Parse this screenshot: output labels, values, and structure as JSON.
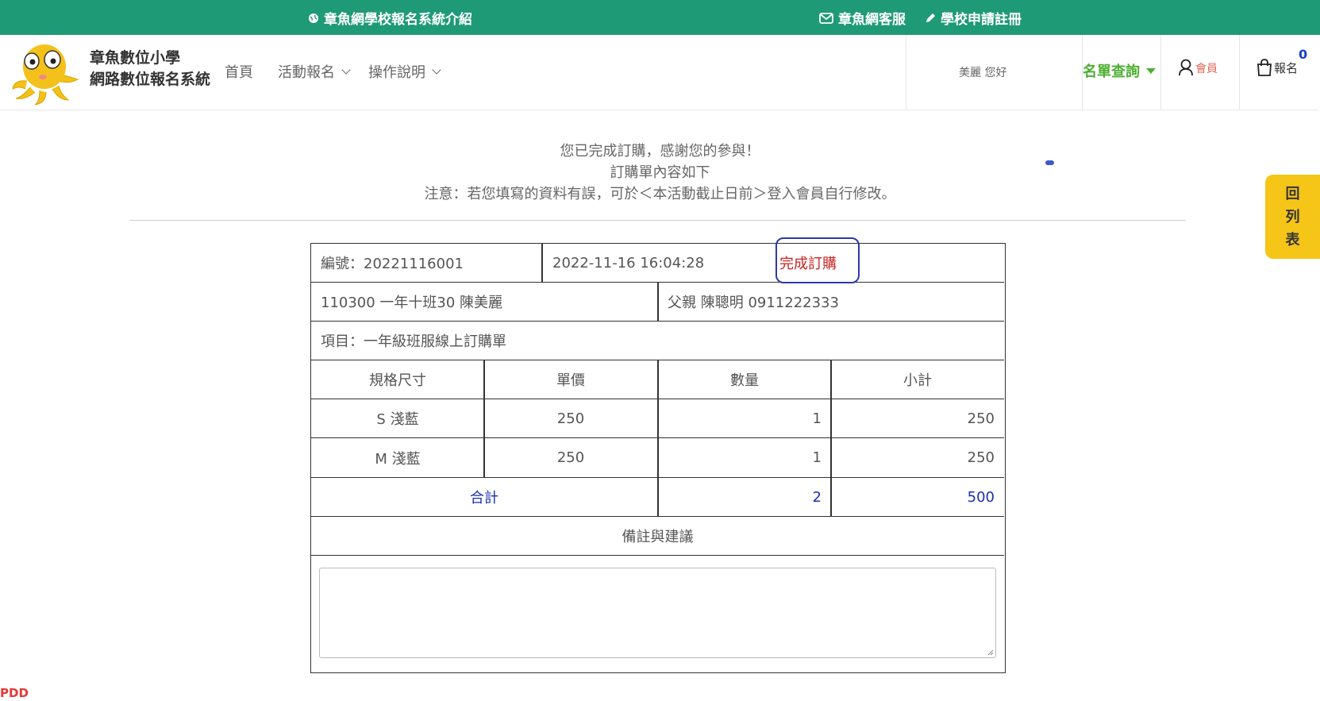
{
  "topbar": {
    "intro": "章魚網學校報名系統介紹",
    "service": "章魚網客服",
    "register": "學校申請註冊",
    "bg_color": "#1f9a76"
  },
  "header": {
    "brand_line1": "章魚數位小學",
    "brand_line2": "網路數位報名系統",
    "nav": {
      "home": "首頁",
      "activity": "活動報名",
      "help": "操作說明"
    },
    "greeting": "美麗 您好",
    "list_query": "名單查詢",
    "member": "會員",
    "signup": "報名",
    "cart_count": "0"
  },
  "messages": {
    "line1": "您已完成訂購，感謝您的參與！",
    "line2": "訂購單內容如下",
    "line3": "注意：若您填寫的資料有誤，可於＜本活動截止日前＞登入會員自行修改。"
  },
  "side_tab": {
    "text": "回列表"
  },
  "order": {
    "number": "編號：20221116001",
    "datetime": "2022-11-16 16:04:28",
    "status": "完成訂購",
    "student": "110300 一年十班30 陳美麗",
    "guardian": "父親 陳聰明 0911222333",
    "item": "項目：一年級班服線上訂購單",
    "columns": [
      "規格尺寸",
      "單價",
      "數量",
      "小計"
    ],
    "rows": [
      {
        "spec": "S 淺藍",
        "price": "250",
        "qty": "1",
        "subtotal": "250"
      },
      {
        "spec": "M 淺藍",
        "price": "250",
        "qty": "1",
        "subtotal": "250"
      }
    ],
    "total_label": "合計",
    "total_qty": "2",
    "total_amount": "500",
    "notes_label": "備註與建議",
    "notes_value": ""
  },
  "footer_mark": "PDD",
  "colors": {
    "accent_green": "#4caf30",
    "status_red": "#cc2222",
    "total_blue": "#1a2fb3",
    "side_tab_yellow": "#f5c518"
  }
}
